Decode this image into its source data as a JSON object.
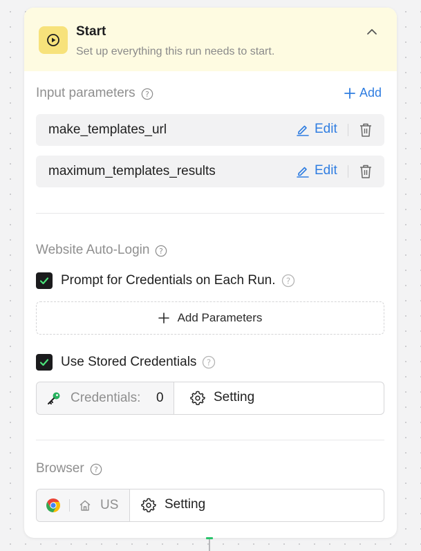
{
  "header": {
    "title": "Start",
    "subtitle": "Set up everything this run needs to start."
  },
  "input_params": {
    "label": "Input parameters",
    "add_label": "Add",
    "items": [
      {
        "name": "make_templates_url",
        "edit_label": "Edit"
      },
      {
        "name": "maximum_templates_results",
        "edit_label": "Edit"
      }
    ]
  },
  "auto_login": {
    "label": "Website Auto-Login",
    "prompt_label": "Prompt for Credentials on Each Run.",
    "prompt_checked": true,
    "add_params_label": "Add Parameters",
    "stored_label": "Use Stored Credentials",
    "stored_checked": true,
    "credentials_label": "Credentials:",
    "credentials_count": "0",
    "setting_label": "Setting"
  },
  "browser": {
    "label": "Browser",
    "region": "US",
    "setting_label": "Setting"
  },
  "colors": {
    "accent": "#2f7de1",
    "header_bg": "#fefbe1",
    "play_bg": "#f7e27b",
    "check_green": "#4be37a"
  }
}
